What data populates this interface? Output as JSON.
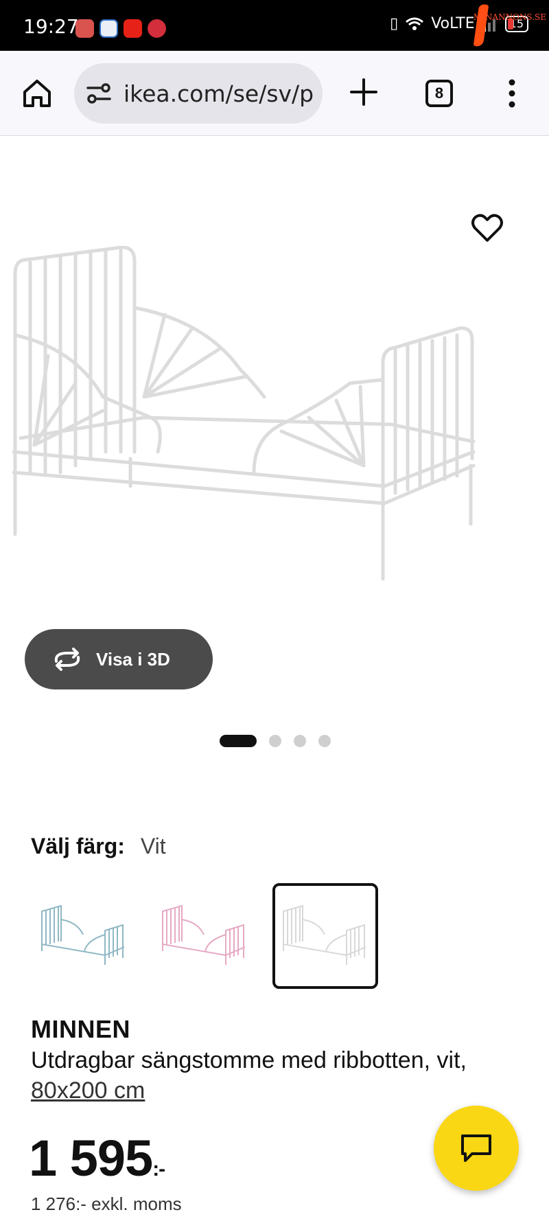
{
  "status_bar": {
    "time": "19:27",
    "network": "VoLTE",
    "battery": "15",
    "watermark": "MINANNONS.SE"
  },
  "browser": {
    "url": "ikea.com/se/sv/p",
    "tab_count": "8"
  },
  "gallery": {
    "view_3d_label": "Visa i 3D",
    "image_count": 4,
    "active_index": 0
  },
  "color_picker": {
    "label": "Välj färg:",
    "selected_value": "Vit",
    "options": [
      {
        "name": "turquoise",
        "color": "#8fb8c4",
        "selected": false
      },
      {
        "name": "pink",
        "color": "#e6a9c4",
        "selected": false
      },
      {
        "name": "white",
        "color": "#e8e8e8",
        "selected": true
      }
    ]
  },
  "product": {
    "name": "MINNEN",
    "description": "Utdragbar sängstomme med ribbotten, vit,",
    "size": "80x200 cm",
    "price": "1 595",
    "price_suffix": ":-",
    "price_ex_vat": "1 276:- exkl. moms"
  },
  "colors": {
    "chat_button": "#fad714",
    "button_3d": "#4b4b4b"
  }
}
